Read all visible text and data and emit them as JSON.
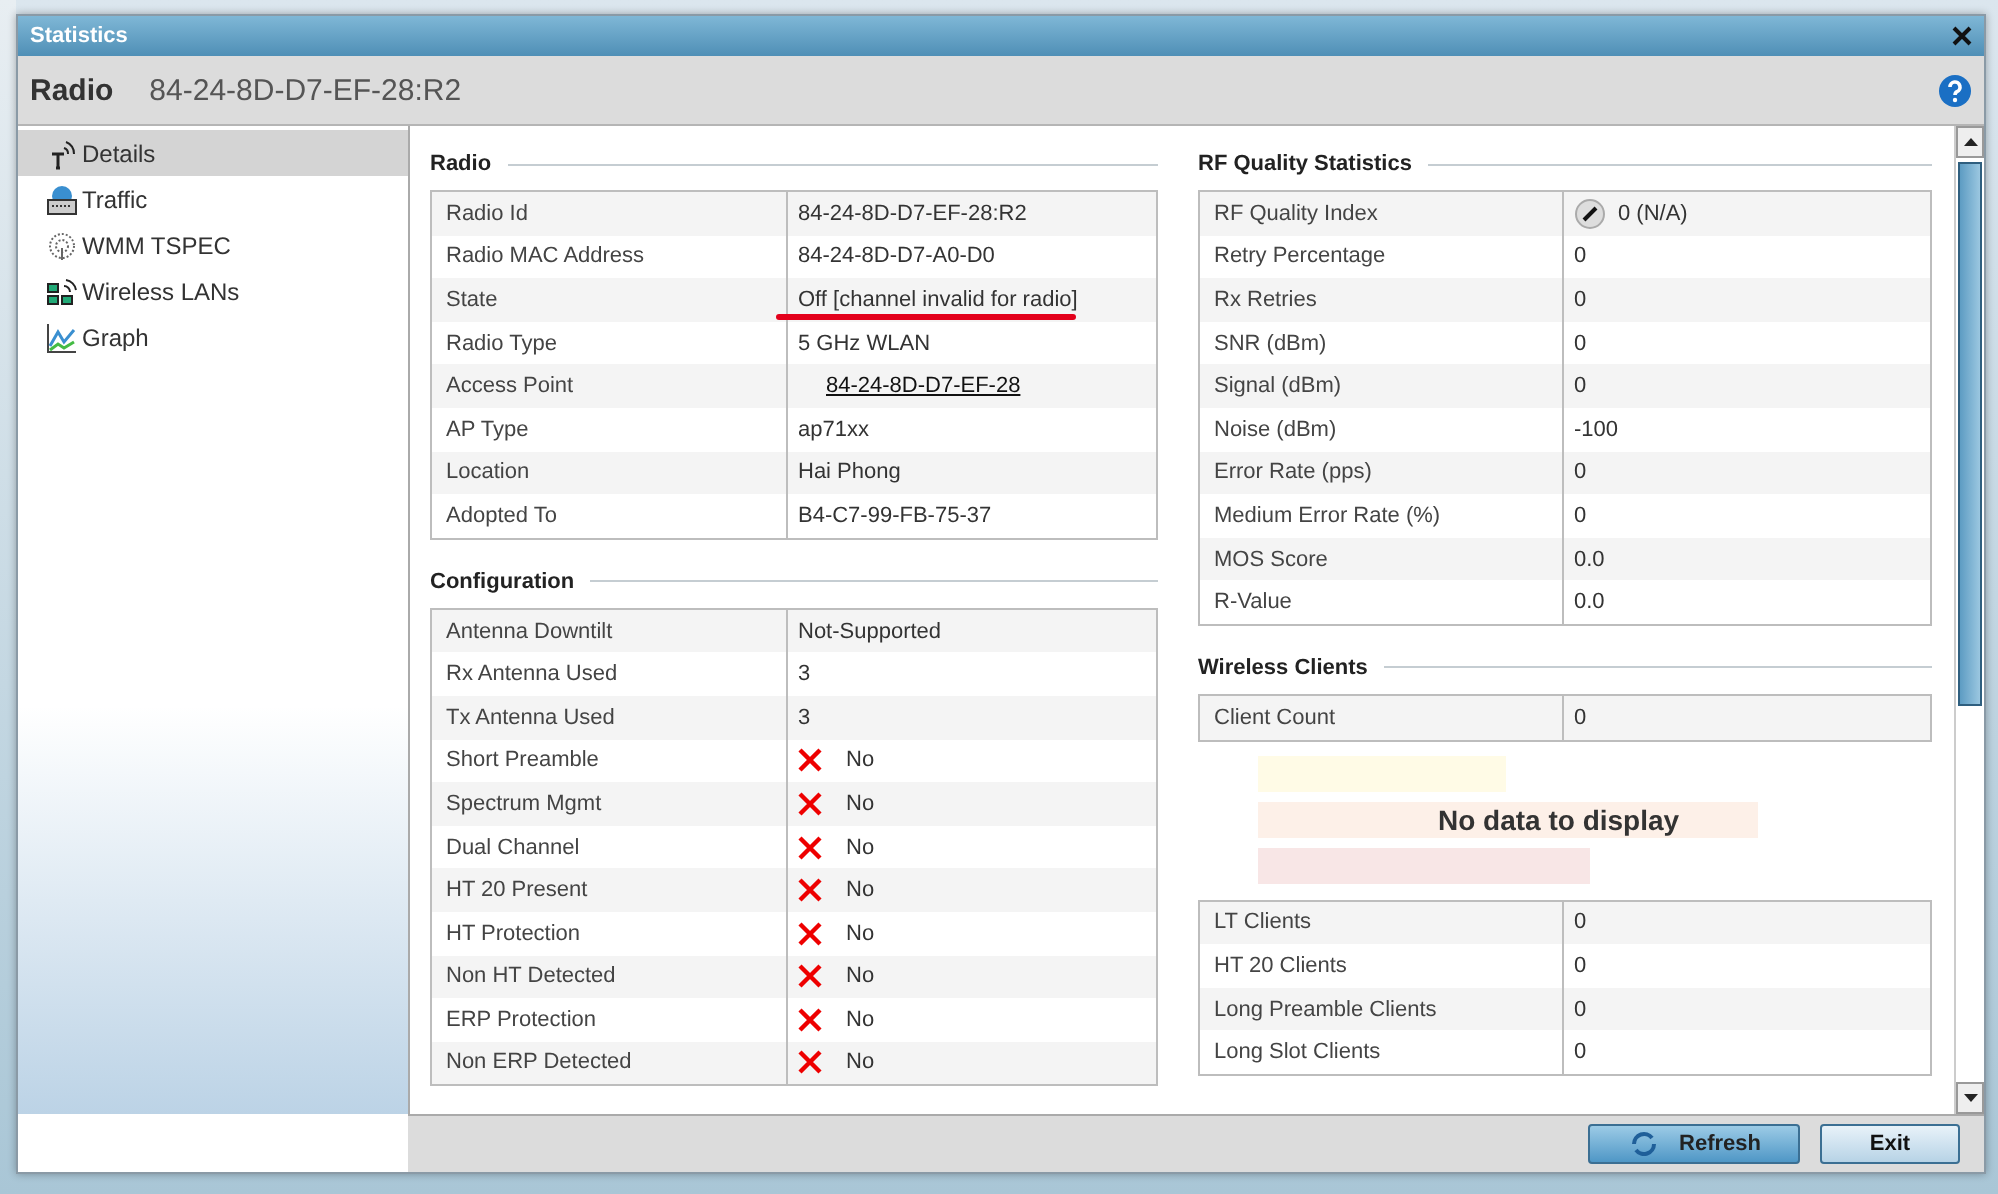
{
  "window": {
    "title": "Statistics"
  },
  "header": {
    "label": "Radio",
    "value": "84-24-8D-D7-EF-28:R2"
  },
  "sidebar": {
    "items": [
      {
        "label": "Details",
        "selected": true,
        "kind": "antenna"
      },
      {
        "label": "Traffic",
        "selected": false,
        "kind": "traffic"
      },
      {
        "label": "WMM TSPEC",
        "selected": false,
        "kind": "wmm"
      },
      {
        "label": "Wireless LANs",
        "selected": false,
        "kind": "wlan"
      },
      {
        "label": "Graph",
        "selected": false,
        "kind": "graph"
      }
    ]
  },
  "radio": {
    "title": "Radio",
    "rows": [
      {
        "label": "Radio Id",
        "value": "84-24-8D-D7-EF-28:R2",
        "kind": "text",
        "marked": false
      },
      {
        "label": "Radio MAC Address",
        "value": "84-24-8D-D7-A0-D0",
        "kind": "text",
        "marked": false
      },
      {
        "label": "State",
        "value": "Off [channel invalid for radio]",
        "kind": "text",
        "marked": true
      },
      {
        "label": "Radio Type",
        "value": "5 GHz WLAN",
        "kind": "text",
        "marked": false
      },
      {
        "label": "Access Point",
        "value": "84-24-8D-D7-EF-28",
        "kind": "link",
        "marked": false
      },
      {
        "label": "AP Type",
        "value": "ap71xx",
        "kind": "text",
        "marked": false
      },
      {
        "label": "Location",
        "value": "Hai Phong",
        "kind": "text",
        "marked": false
      },
      {
        "label": "Adopted To",
        "value": "B4-C7-99-FB-75-37",
        "kind": "text",
        "marked": false
      }
    ]
  },
  "configuration": {
    "title": "Configuration",
    "rows": [
      {
        "label": "Antenna Downtilt",
        "value": "Not-Supported",
        "kind": "text"
      },
      {
        "label": "Rx Antenna Used",
        "value": "3",
        "kind": "text"
      },
      {
        "label": "Tx Antenna Used",
        "value": "3",
        "kind": "text"
      },
      {
        "label": "Short Preamble",
        "value": "No",
        "kind": "flag",
        "enabled": false
      },
      {
        "label": "Spectrum Mgmt",
        "value": "No",
        "kind": "flag",
        "enabled": false
      },
      {
        "label": "Dual Channel",
        "value": "No",
        "kind": "flag",
        "enabled": false
      },
      {
        "label": "HT 20 Present",
        "value": "No",
        "kind": "flag",
        "enabled": false
      },
      {
        "label": "HT Protection",
        "value": "No",
        "kind": "flag",
        "enabled": false
      },
      {
        "label": "Non HT Detected",
        "value": "No",
        "kind": "flag",
        "enabled": false
      },
      {
        "label": "ERP Protection",
        "value": "No",
        "kind": "flag",
        "enabled": false
      },
      {
        "label": "Non ERP Detected",
        "value": "No",
        "kind": "flag",
        "enabled": false
      }
    ]
  },
  "rf_quality": {
    "title": "RF Quality Statistics",
    "rows": [
      {
        "label": "RF Quality Index",
        "value": "0 (N/A)",
        "kind": "gauge"
      },
      {
        "label": "Retry Percentage",
        "value": "0",
        "kind": "text"
      },
      {
        "label": "Rx Retries",
        "value": "0",
        "kind": "text"
      },
      {
        "label": "SNR (dBm)",
        "value": "0",
        "kind": "text"
      },
      {
        "label": "Signal (dBm)",
        "value": "0",
        "kind": "text"
      },
      {
        "label": "Noise (dBm)",
        "value": "-100",
        "kind": "text"
      },
      {
        "label": "Error Rate (pps)",
        "value": "0",
        "kind": "text"
      },
      {
        "label": "Medium Error Rate (%)",
        "value": "0",
        "kind": "text"
      },
      {
        "label": "MOS Score",
        "value": "0.0",
        "kind": "text"
      },
      {
        "label": "R-Value",
        "value": "0.0",
        "kind": "text"
      }
    ]
  },
  "wireless_clients": {
    "title": "Wireless Clients",
    "count": {
      "label": "Client Count",
      "value": "0"
    },
    "chart_message": "No data to display",
    "rows": [
      {
        "label": "LT Clients",
        "value": "0"
      },
      {
        "label": "HT 20 Clients",
        "value": "0"
      },
      {
        "label": "Long Preamble Clients",
        "value": "0"
      },
      {
        "label": "Long Slot Clients",
        "value": "0"
      }
    ]
  },
  "buttons": [
    {
      "label": "Refresh",
      "kind": "primary"
    },
    {
      "label": "Exit",
      "kind": "plain"
    }
  ]
}
